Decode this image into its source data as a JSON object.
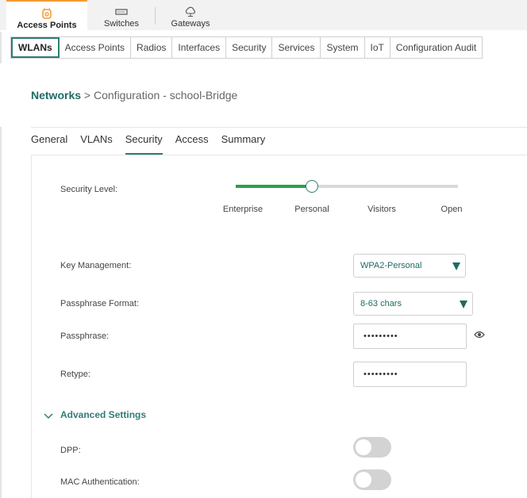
{
  "device_tabs": [
    {
      "label": "Access Points",
      "icon": "access-point-icon",
      "active": true
    },
    {
      "label": "Switches",
      "icon": "switch-icon",
      "active": false
    },
    {
      "label": "Gateways",
      "icon": "gateway-cloud-icon",
      "active": false
    }
  ],
  "sub_tabs": [
    "WLANs",
    "Access Points",
    "Radios",
    "Interfaces",
    "Security",
    "Services",
    "System",
    "IoT",
    "Configuration Audit"
  ],
  "breadcrumb": {
    "link": "Networks",
    "separator": " > ",
    "rest": "Configuration - school-Bridge"
  },
  "page_tabs": [
    "General",
    "VLANs",
    "Security",
    "Access",
    "Summary"
  ],
  "security_level": {
    "label": "Security Level:",
    "options": [
      "Enterprise",
      "Personal",
      "Visitors",
      "Open"
    ],
    "selected": "Personal"
  },
  "key_management": {
    "label": "Key Management:",
    "value": "WPA2-Personal"
  },
  "passphrase_format": {
    "label": "Passphrase Format:",
    "value": "8-63 chars"
  },
  "passphrase": {
    "label": "Passphrase:",
    "value": "•••••••••"
  },
  "retype": {
    "label": "Retype:",
    "value": "•••••••••"
  },
  "advanced": {
    "label": "Advanced Settings",
    "expanded": true
  },
  "dpp": {
    "label": "DPP:",
    "enabled": false
  },
  "mac_auth": {
    "label": "MAC Authentication:",
    "enabled": false
  },
  "colors": {
    "accent": "#2f7d74",
    "slider_fill": "#2aa04a",
    "active_tab_top": "#f39c33"
  }
}
